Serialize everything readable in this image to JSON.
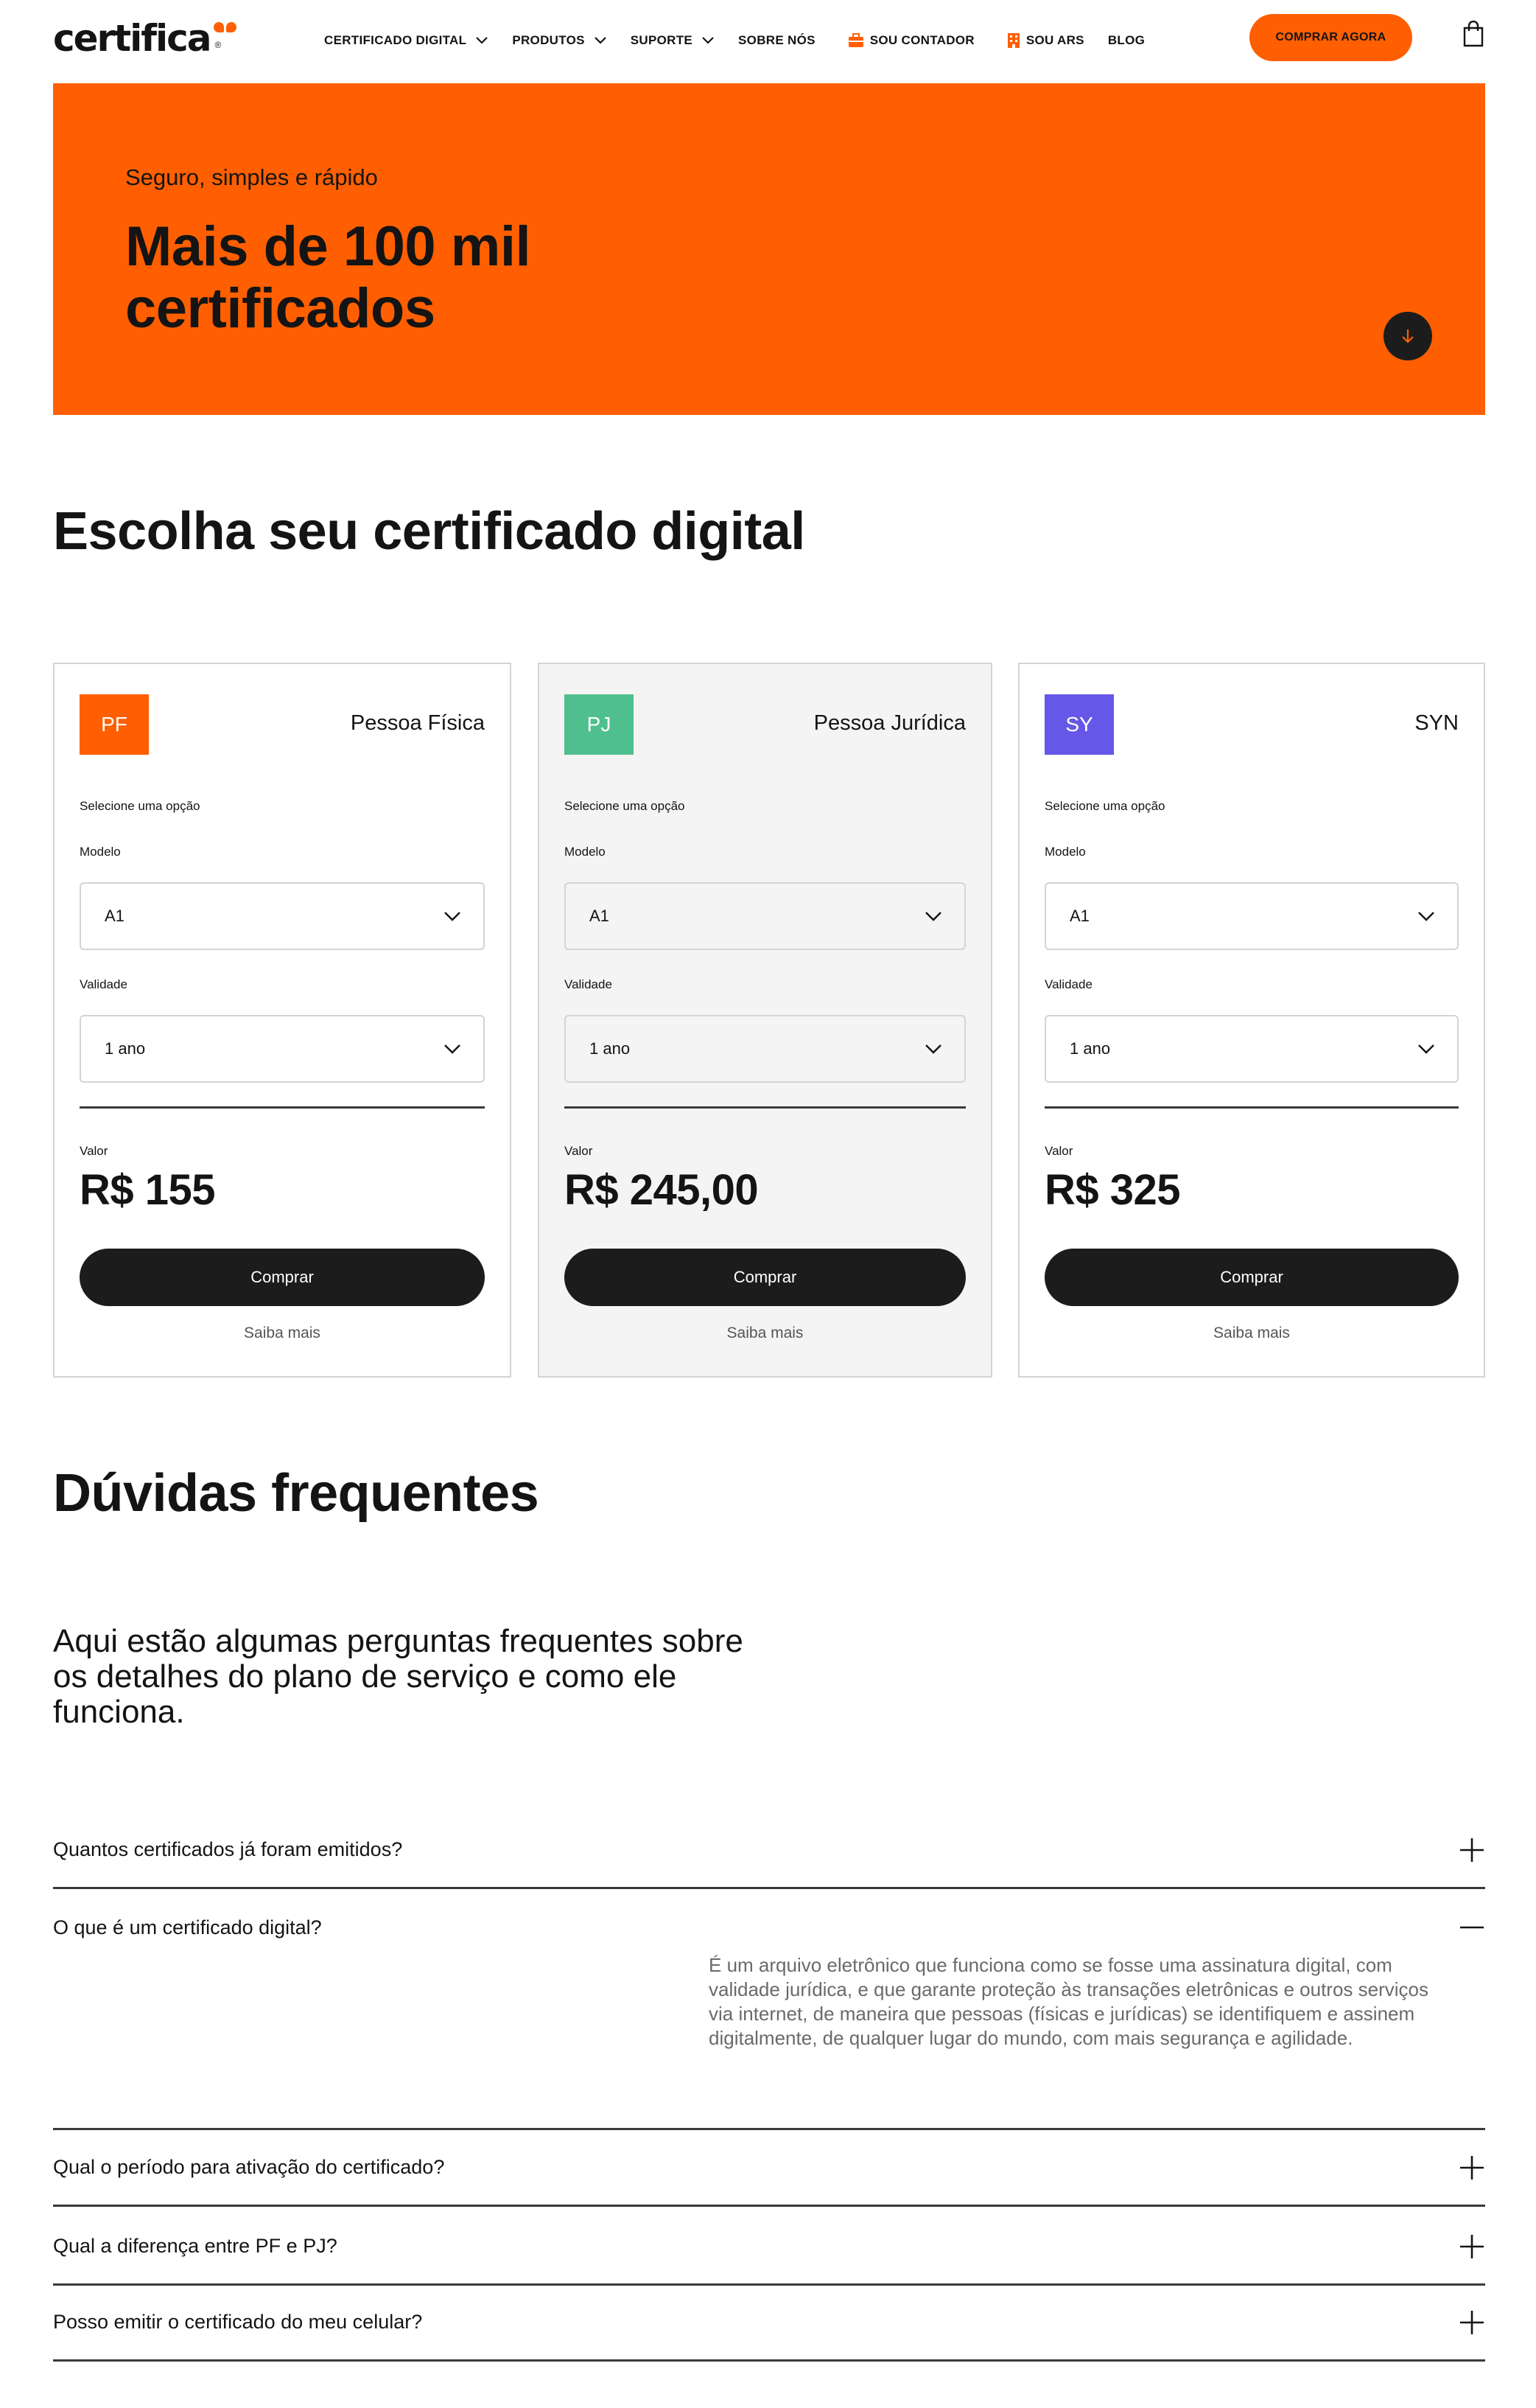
{
  "brand": {
    "name": "certifica",
    "accent": "#ff5f00"
  },
  "nav": {
    "items": [
      {
        "label": "CERTIFICADO DIGITAL",
        "icon": "chevron-down-icon"
      },
      {
        "label": "PRODUTOS",
        "icon": "chevron-down-icon"
      },
      {
        "label": "SUPORTE",
        "icon": "chevron-down-icon"
      },
      {
        "label": "SOBRE NÓS"
      },
      {
        "label": "SOU CONTADOR",
        "icon": "briefcase-icon"
      },
      {
        "label": "SOU ARS",
        "icon": "building-icon"
      },
      {
        "label": "BLOG"
      }
    ],
    "cta_label": "COMPRAR AGORA",
    "cart_icon": "shopping-bag-icon"
  },
  "hero": {
    "subtitle": "Seguro, simples e rápido",
    "title": "Mais de 100 mil certificados",
    "scroll_icon": "arrow-down-icon"
  },
  "choose": {
    "title": "Escolha seu certificado digital",
    "cards": [
      {
        "badge": "PF",
        "badge_color": "#ff5f00",
        "name": "Pessoa Física",
        "select_label": "Selecione uma opção",
        "model_label": "Modelo",
        "model_value": "A1",
        "validity_label": "Validade",
        "validity_value": "1 ano",
        "value_label": "Valor",
        "price": "R$ 155",
        "buy_label": "Comprar",
        "more_label": "Saiba mais"
      },
      {
        "badge": "PJ",
        "badge_color": "#4fc08d",
        "name": "Pessoa Jurídica",
        "select_label": "Selecione uma opção",
        "model_label": "Modelo",
        "model_value": "A1",
        "validity_label": "Validade",
        "validity_value": "1 ano",
        "value_label": "Valor",
        "price": "R$ 245,00",
        "buy_label": "Comprar",
        "more_label": "Saiba mais"
      },
      {
        "badge": "SY",
        "badge_color": "#6557e8",
        "name": "SYN",
        "select_label": "Selecione uma opção",
        "model_label": "Modelo",
        "model_value": "A1",
        "validity_label": "Validade",
        "validity_value": "1 ano",
        "value_label": "Valor",
        "price": "R$ 325",
        "buy_label": "Comprar",
        "more_label": "Saiba mais"
      }
    ]
  },
  "faq": {
    "title": "Dúvidas frequentes",
    "intro": "Aqui estão algumas perguntas frequentes sobre os detalhes do plano de serviço e como ele funciona.",
    "items": [
      {
        "question": "Quantos certificados já foram emitidos?",
        "state": "collapsed"
      },
      {
        "question": "O que é um certificado digital?",
        "state": "expanded",
        "answer": "É um arquivo eletrônico que funciona como se fosse uma assinatura digital, com validade jurídica, e que garante proteção às transações eletrônicas e outros serviços via internet, de maneira que pessoas (físicas e jurídicas) se identifiquem e assinem digitalmente, de qualquer lugar do mundo, com mais segurança e agilidade."
      },
      {
        "question": "Qual o período para ativação do certificado?",
        "state": "collapsed"
      },
      {
        "question": "Qual a diferença entre PF e PJ?",
        "state": "collapsed"
      },
      {
        "question": "Posso emitir o certificado do meu celular?",
        "state": "collapsed"
      }
    ]
  }
}
